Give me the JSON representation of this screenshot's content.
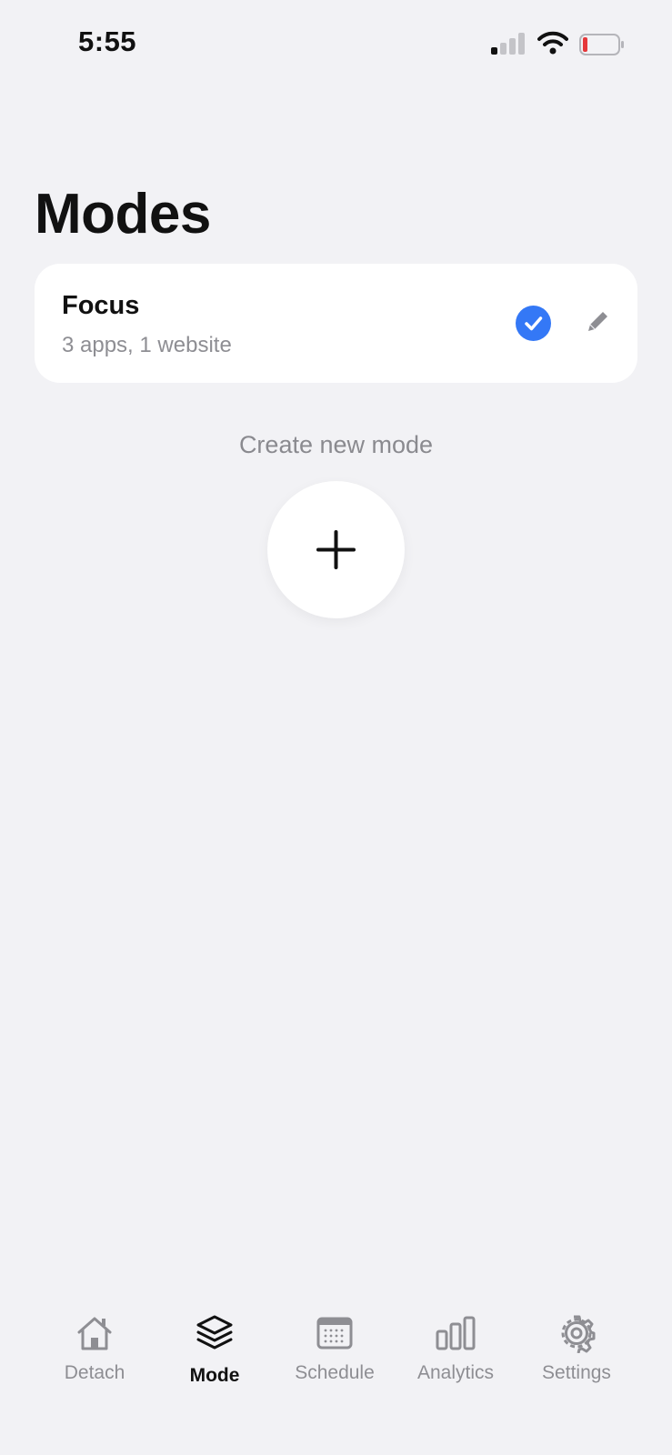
{
  "status_bar": {
    "time": "5:55",
    "battery_color": "#e5383b"
  },
  "page": {
    "title": "Modes"
  },
  "modes": [
    {
      "name": "Focus",
      "summary": "3 apps, 1 website",
      "selected": true
    }
  ],
  "create": {
    "label": "Create new mode"
  },
  "tab_bar": {
    "tabs": [
      {
        "label": "Detach",
        "icon": "home-icon",
        "active": false
      },
      {
        "label": "Mode",
        "icon": "layers-icon",
        "active": true
      },
      {
        "label": "Schedule",
        "icon": "calendar-icon",
        "active": false
      },
      {
        "label": "Analytics",
        "icon": "bar-chart-icon",
        "active": false
      },
      {
        "label": "Settings",
        "icon": "gear-icon",
        "active": false
      }
    ]
  },
  "colors": {
    "accent": "#3478f6",
    "background": "#f2f2f5",
    "card": "#ffffff",
    "secondary_text": "#8e8e93"
  }
}
